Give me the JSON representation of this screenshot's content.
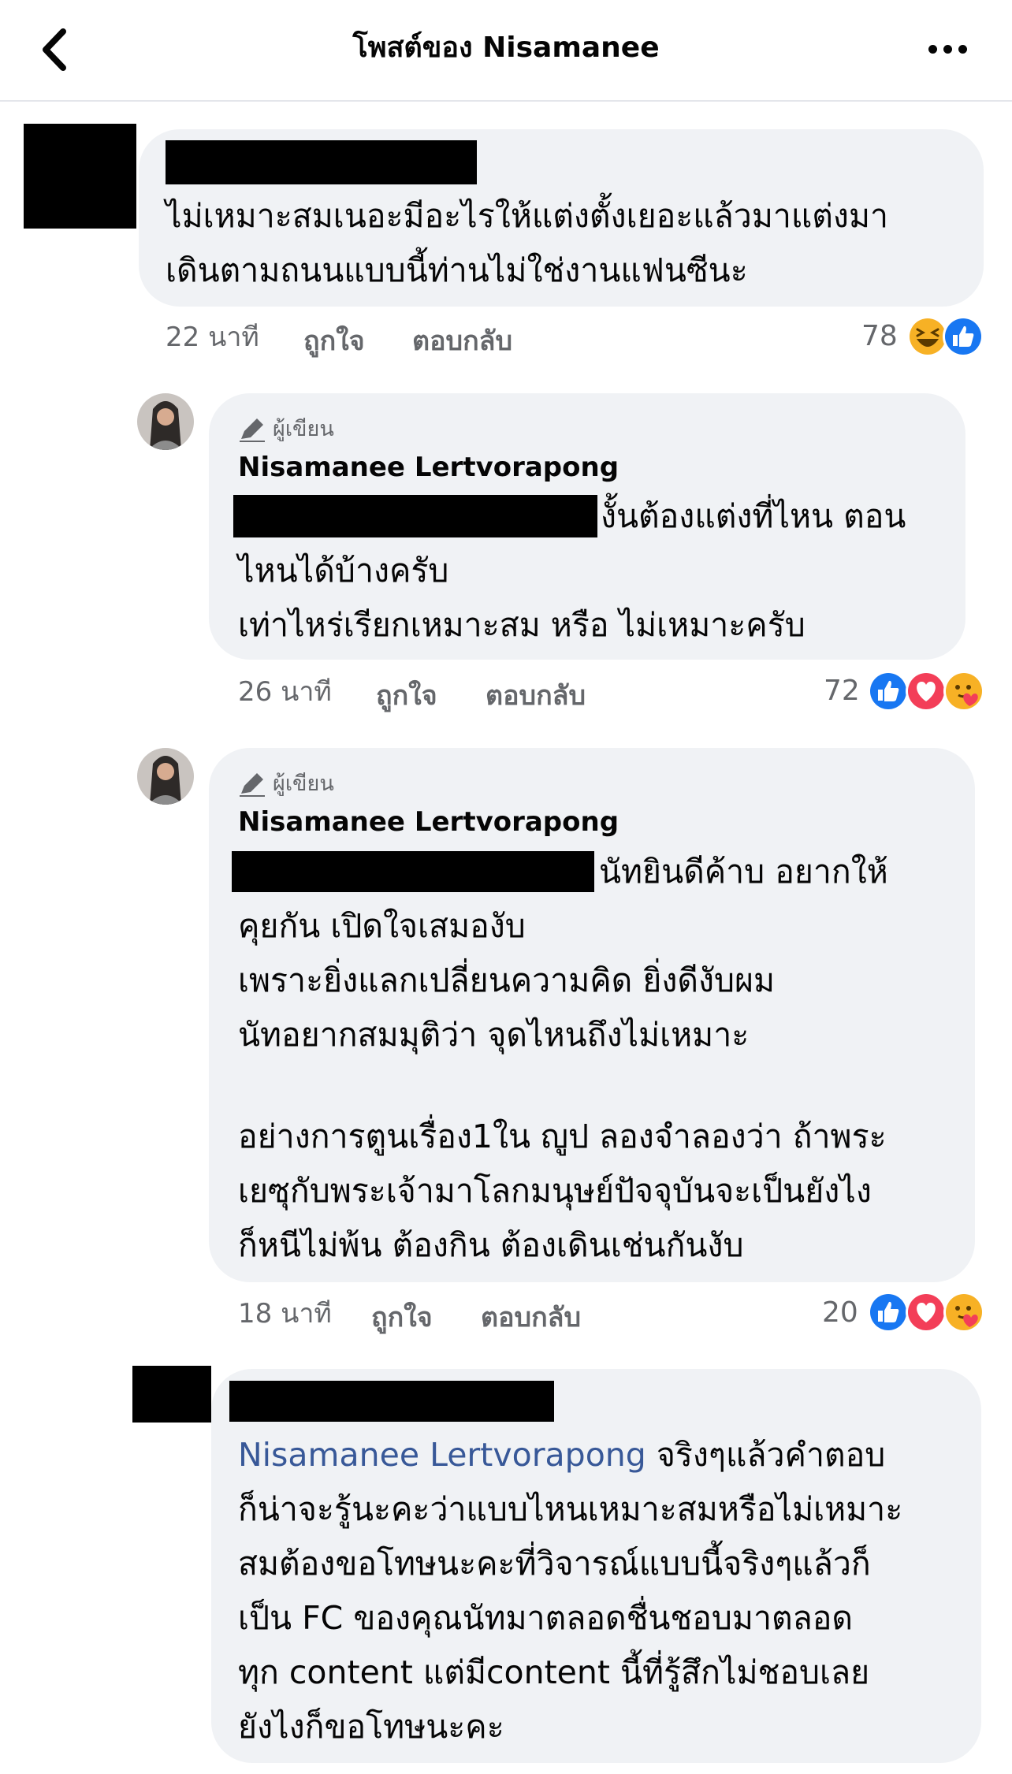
{
  "header": {
    "title": "โพสต์ของ Nisamanee"
  },
  "comments": [
    {
      "lines": [
        "ไม่เหมาะสมเนอะมีอะไรให้แต่งตั้งเยอะแล้วมาแต่งมา",
        "เดินตามถนนแบบนี้ท่านไม่ใช่งานแฟนซีนะ"
      ],
      "time": "22 นาที",
      "like": "ถูกใจ",
      "reply": "ตอบกลับ",
      "count": "78",
      "reactions": [
        "haha",
        "like"
      ]
    },
    {
      "badge": "ผู้เขียน",
      "author": "Nisamanee Lertvorapong",
      "lines": [
        "งั้นต้องแต่งที่ไหน ตอน",
        "ไหนได้บ้างครับ",
        "เท่าไหร่เรียกเหมาะสม หรือ ไม่เหมาะครับ"
      ],
      "time": "26 นาที",
      "like": "ถูกใจ",
      "reply": "ตอบกลับ",
      "count": "72",
      "reactions": [
        "like",
        "love",
        "care"
      ]
    },
    {
      "badge": "ผู้เขียน",
      "author": "Nisamanee Lertvorapong",
      "lines": [
        "นัทยินดีค้าบ อยากให้",
        "คุยกัน เปิดใจเสมองับ",
        "เพราะยิ่งแลกเปลี่ยนความคิด ยิ่งดีงับผม",
        "นัทอยากสมมุติว่า จุดไหนถึงไม่เหมาะ",
        "อย่างการตูนเรื่อง1ใน ญูป ลองจำลองว่า ถ้าพระ",
        "เยซุกับพระเจ้ามาโลกมนุษย์ปัจจุบันจะเป็นยังไง",
        "ก็หนีไม่พ้น ต้องกิน ต้องเดินเช่นกันงับ"
      ],
      "time": "18 นาที",
      "like": "ถูกใจ",
      "reply": "ตอบกลับ",
      "count": "20",
      "reactions": [
        "like",
        "love",
        "care"
      ]
    },
    {
      "mention": "Nisamanee Lertvorapong",
      "lines": [
        "จริงๆแล้วคำตอบ",
        "ก็น่าจะรู้นะคะว่าแบบไหนเหมาะสมหรือไม่เหมาะ",
        "สมต้องขอโทษนะคะที่วิจารณ์แบบนี้จริงๆแล้วก็",
        "เป็น FC ของคุณนัทมาตลอดชื่นชอบมาตลอด",
        "ทุก content แต่มีcontent นี้ที่รู้สึกไม่ชอบเลย",
        "ยังไงก็ขอโทษนะคะ"
      ]
    }
  ],
  "colors": {
    "bubble": "#f0f2f5",
    "like": "#1877f2",
    "love": "#f33e58",
    "care": "#f7b125",
    "mention": "#385898",
    "meta": "#65676b"
  },
  "icons": {
    "back": "chevron-left-icon",
    "more": "more-dots-icon",
    "badge": "pencil-icon"
  }
}
